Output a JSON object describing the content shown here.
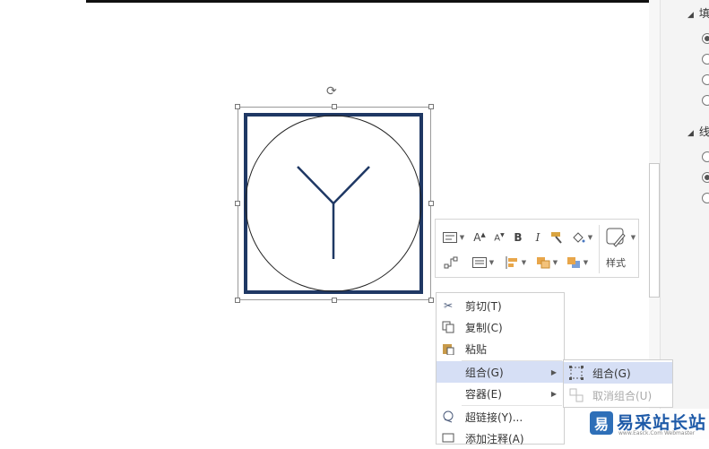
{
  "right_panel": {
    "section1_label": "填",
    "section2_label": "线"
  },
  "mini_toolbar": {
    "style_label": "样式"
  },
  "context_menu": {
    "items": [
      {
        "label": "剪切(T)",
        "icon": "scissors-icon"
      },
      {
        "label": "复制(C)",
        "icon": "copy-icon"
      },
      {
        "label": "粘贴",
        "icon": "paste-icon"
      },
      {
        "label": "组合(G)",
        "icon": "none",
        "has_submenu": true,
        "highlighted": true
      },
      {
        "label": "容器(E)",
        "icon": "none",
        "has_submenu": true
      },
      {
        "label": "超链接(Y)...",
        "icon": "hyperlink-icon"
      },
      {
        "label": "添加注释(A)",
        "icon": "comment-icon"
      }
    ]
  },
  "submenu": {
    "items": [
      {
        "label": "组合(G)",
        "highlighted": true
      },
      {
        "label": "取消组合(U)",
        "disabled": true
      }
    ]
  },
  "watermark": {
    "logo_text": "易",
    "text": "易采站长站",
    "sub": "www.Easck.Com Webmaster"
  },
  "colors": {
    "shape_stroke": "#1f3864",
    "menu_highlight": "#d6dff5"
  }
}
